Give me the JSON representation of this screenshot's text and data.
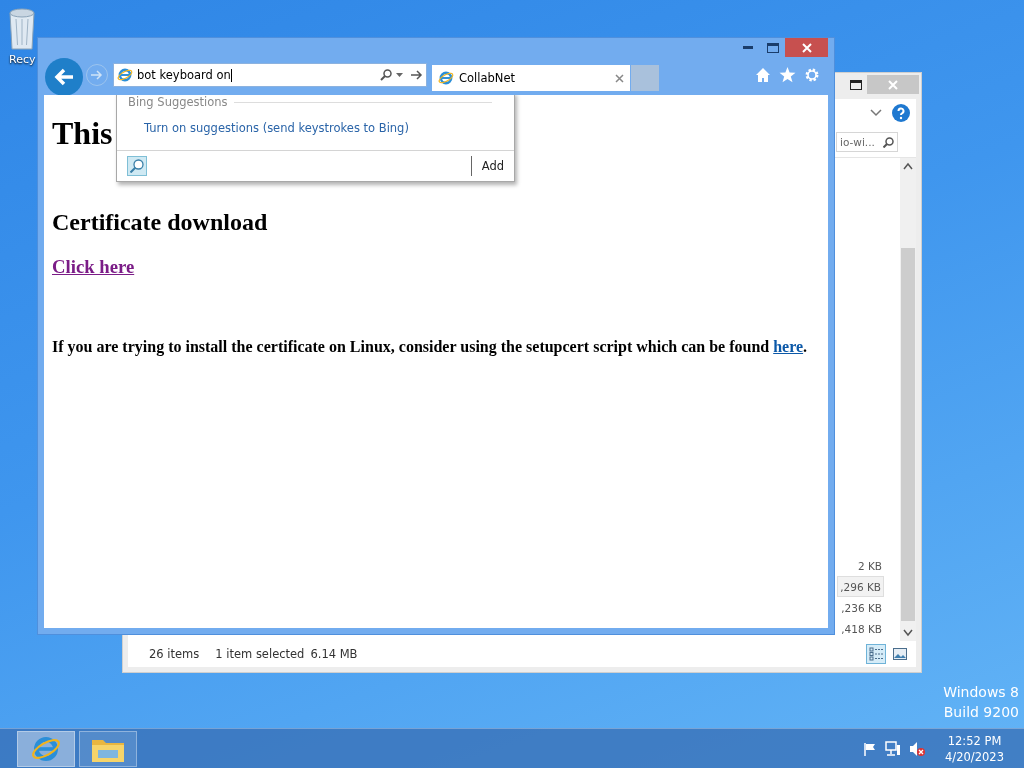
{
  "desktop": {
    "icons": [
      {
        "label": "Recy"
      }
    ],
    "watermark": [
      "Windows 8",
      "Build 9200"
    ]
  },
  "explorer_window": {
    "search": {
      "value": "io-wi..."
    },
    "rows": [
      {
        "size": "2 KB",
        "selected": false
      },
      {
        "size": ",296 KB",
        "selected": true
      },
      {
        "size": ",236 KB",
        "selected": false
      },
      {
        "size": ",418 KB",
        "selected": false
      }
    ],
    "status_bar": {
      "count": "26 items",
      "selection": "1 item selected",
      "selection_size": "6.14 MB"
    },
    "views": [
      {
        "kind": "details",
        "selected": true
      },
      {
        "kind": "thumbnails",
        "selected": false
      }
    ]
  },
  "browser": {
    "address": {
      "value": "bot keyboard on"
    },
    "tabs": [
      {
        "label": "CollabNet",
        "selected": true
      }
    ],
    "suggestions": {
      "header": "Bing Suggestions",
      "items": [
        "Turn on suggestions (send keystrokes to Bing)"
      ],
      "add": "Add"
    },
    "page": {
      "heading": "This",
      "subheading": "Certificate download",
      "download_link": "Click here",
      "note": {
        "text": "If you are trying to install the certificate on Linux, consider using the setupcert script which can be found ",
        "link": "here",
        "end": "."
      }
    }
  },
  "taskbar": {
    "apps": [
      {
        "kind": "browser",
        "selected": true
      },
      {
        "kind": "folder",
        "selected": false
      }
    ],
    "clock": {
      "time": "12:52 PM",
      "date": "4/20/2023"
    }
  }
}
